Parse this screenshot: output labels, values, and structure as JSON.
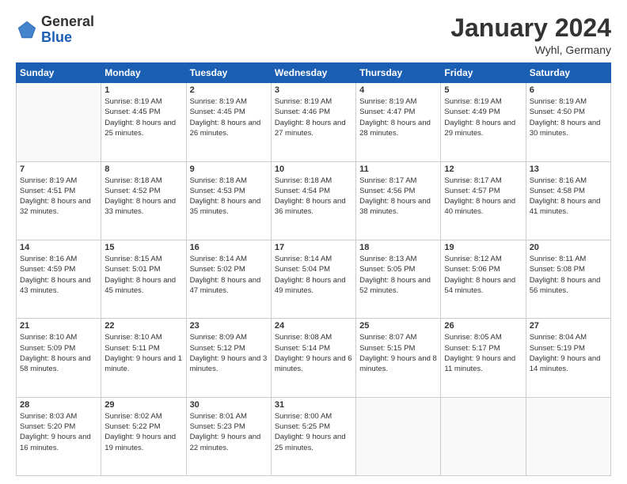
{
  "logo": {
    "general": "General",
    "blue": "Blue"
  },
  "header": {
    "title": "January 2024",
    "subtitle": "Wyhl, Germany"
  },
  "weekdays": [
    "Sunday",
    "Monday",
    "Tuesday",
    "Wednesday",
    "Thursday",
    "Friday",
    "Saturday"
  ],
  "weeks": [
    [
      {
        "day": "",
        "empty": true
      },
      {
        "day": "1",
        "sunrise": "Sunrise: 8:19 AM",
        "sunset": "Sunset: 4:45 PM",
        "daylight": "Daylight: 8 hours and 25 minutes."
      },
      {
        "day": "2",
        "sunrise": "Sunrise: 8:19 AM",
        "sunset": "Sunset: 4:45 PM",
        "daylight": "Daylight: 8 hours and 26 minutes."
      },
      {
        "day": "3",
        "sunrise": "Sunrise: 8:19 AM",
        "sunset": "Sunset: 4:46 PM",
        "daylight": "Daylight: 8 hours and 27 minutes."
      },
      {
        "day": "4",
        "sunrise": "Sunrise: 8:19 AM",
        "sunset": "Sunset: 4:47 PM",
        "daylight": "Daylight: 8 hours and 28 minutes."
      },
      {
        "day": "5",
        "sunrise": "Sunrise: 8:19 AM",
        "sunset": "Sunset: 4:49 PM",
        "daylight": "Daylight: 8 hours and 29 minutes."
      },
      {
        "day": "6",
        "sunrise": "Sunrise: 8:19 AM",
        "sunset": "Sunset: 4:50 PM",
        "daylight": "Daylight: 8 hours and 30 minutes."
      }
    ],
    [
      {
        "day": "7",
        "sunrise": "Sunrise: 8:19 AM",
        "sunset": "Sunset: 4:51 PM",
        "daylight": "Daylight: 8 hours and 32 minutes."
      },
      {
        "day": "8",
        "sunrise": "Sunrise: 8:18 AM",
        "sunset": "Sunset: 4:52 PM",
        "daylight": "Daylight: 8 hours and 33 minutes."
      },
      {
        "day": "9",
        "sunrise": "Sunrise: 8:18 AM",
        "sunset": "Sunset: 4:53 PM",
        "daylight": "Daylight: 8 hours and 35 minutes."
      },
      {
        "day": "10",
        "sunrise": "Sunrise: 8:18 AM",
        "sunset": "Sunset: 4:54 PM",
        "daylight": "Daylight: 8 hours and 36 minutes."
      },
      {
        "day": "11",
        "sunrise": "Sunrise: 8:17 AM",
        "sunset": "Sunset: 4:56 PM",
        "daylight": "Daylight: 8 hours and 38 minutes."
      },
      {
        "day": "12",
        "sunrise": "Sunrise: 8:17 AM",
        "sunset": "Sunset: 4:57 PM",
        "daylight": "Daylight: 8 hours and 40 minutes."
      },
      {
        "day": "13",
        "sunrise": "Sunrise: 8:16 AM",
        "sunset": "Sunset: 4:58 PM",
        "daylight": "Daylight: 8 hours and 41 minutes."
      }
    ],
    [
      {
        "day": "14",
        "sunrise": "Sunrise: 8:16 AM",
        "sunset": "Sunset: 4:59 PM",
        "daylight": "Daylight: 8 hours and 43 minutes."
      },
      {
        "day": "15",
        "sunrise": "Sunrise: 8:15 AM",
        "sunset": "Sunset: 5:01 PM",
        "daylight": "Daylight: 8 hours and 45 minutes."
      },
      {
        "day": "16",
        "sunrise": "Sunrise: 8:14 AM",
        "sunset": "Sunset: 5:02 PM",
        "daylight": "Daylight: 8 hours and 47 minutes."
      },
      {
        "day": "17",
        "sunrise": "Sunrise: 8:14 AM",
        "sunset": "Sunset: 5:04 PM",
        "daylight": "Daylight: 8 hours and 49 minutes."
      },
      {
        "day": "18",
        "sunrise": "Sunrise: 8:13 AM",
        "sunset": "Sunset: 5:05 PM",
        "daylight": "Daylight: 8 hours and 52 minutes."
      },
      {
        "day": "19",
        "sunrise": "Sunrise: 8:12 AM",
        "sunset": "Sunset: 5:06 PM",
        "daylight": "Daylight: 8 hours and 54 minutes."
      },
      {
        "day": "20",
        "sunrise": "Sunrise: 8:11 AM",
        "sunset": "Sunset: 5:08 PM",
        "daylight": "Daylight: 8 hours and 56 minutes."
      }
    ],
    [
      {
        "day": "21",
        "sunrise": "Sunrise: 8:10 AM",
        "sunset": "Sunset: 5:09 PM",
        "daylight": "Daylight: 8 hours and 58 minutes."
      },
      {
        "day": "22",
        "sunrise": "Sunrise: 8:10 AM",
        "sunset": "Sunset: 5:11 PM",
        "daylight": "Daylight: 9 hours and 1 minute."
      },
      {
        "day": "23",
        "sunrise": "Sunrise: 8:09 AM",
        "sunset": "Sunset: 5:12 PM",
        "daylight": "Daylight: 9 hours and 3 minutes."
      },
      {
        "day": "24",
        "sunrise": "Sunrise: 8:08 AM",
        "sunset": "Sunset: 5:14 PM",
        "daylight": "Daylight: 9 hours and 6 minutes."
      },
      {
        "day": "25",
        "sunrise": "Sunrise: 8:07 AM",
        "sunset": "Sunset: 5:15 PM",
        "daylight": "Daylight: 9 hours and 8 minutes."
      },
      {
        "day": "26",
        "sunrise": "Sunrise: 8:05 AM",
        "sunset": "Sunset: 5:17 PM",
        "daylight": "Daylight: 9 hours and 11 minutes."
      },
      {
        "day": "27",
        "sunrise": "Sunrise: 8:04 AM",
        "sunset": "Sunset: 5:19 PM",
        "daylight": "Daylight: 9 hours and 14 minutes."
      }
    ],
    [
      {
        "day": "28",
        "sunrise": "Sunrise: 8:03 AM",
        "sunset": "Sunset: 5:20 PM",
        "daylight": "Daylight: 9 hours and 16 minutes."
      },
      {
        "day": "29",
        "sunrise": "Sunrise: 8:02 AM",
        "sunset": "Sunset: 5:22 PM",
        "daylight": "Daylight: 9 hours and 19 minutes."
      },
      {
        "day": "30",
        "sunrise": "Sunrise: 8:01 AM",
        "sunset": "Sunset: 5:23 PM",
        "daylight": "Daylight: 9 hours and 22 minutes."
      },
      {
        "day": "31",
        "sunrise": "Sunrise: 8:00 AM",
        "sunset": "Sunset: 5:25 PM",
        "daylight": "Daylight: 9 hours and 25 minutes."
      },
      {
        "day": "",
        "empty": true
      },
      {
        "day": "",
        "empty": true
      },
      {
        "day": "",
        "empty": true
      }
    ]
  ]
}
